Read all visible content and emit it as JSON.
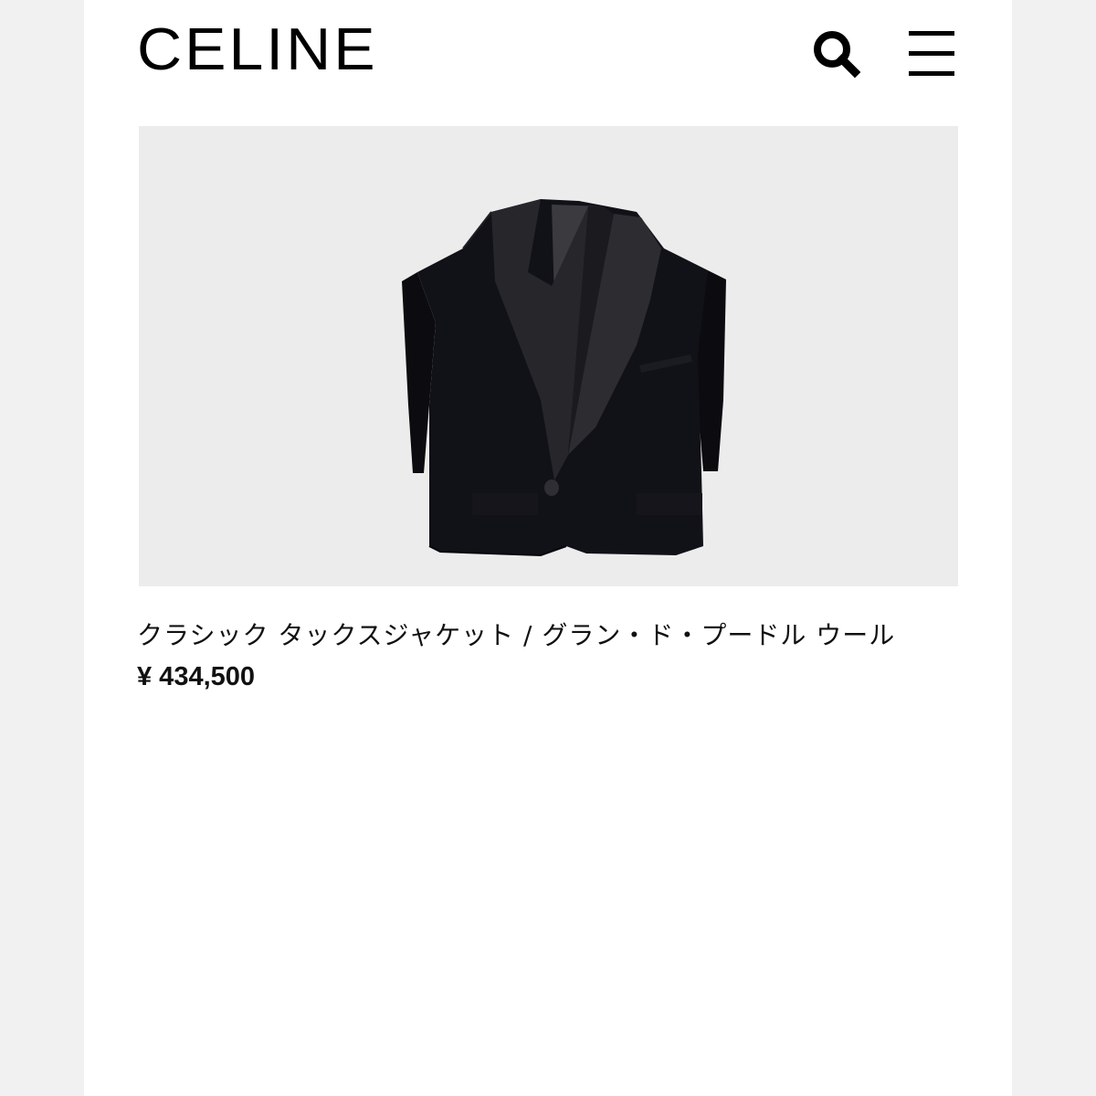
{
  "header": {
    "logo_text": "CELINE",
    "search_icon": "search-icon",
    "menu_icon": "hamburger-menu-icon"
  },
  "product": {
    "image_icon": "tuxedo-jacket-image",
    "title": "クラシック タックスジャケット / グラン・ド・プードル ウール",
    "price": "¥ 434,500"
  },
  "colors": {
    "background": "#ffffff",
    "image_background": "#ececec",
    "text": "#111111"
  }
}
